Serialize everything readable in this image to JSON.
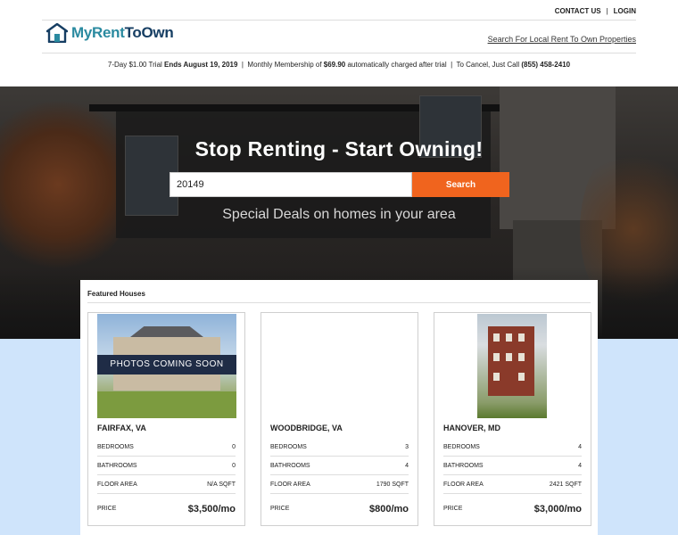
{
  "header": {
    "top_links": {
      "contact": "CONTACT US",
      "separator": "|",
      "login": "LOGIN"
    },
    "logo": {
      "part1": "MyRent",
      "part2": "ToOwn",
      "icon": "house-icon"
    },
    "search_local_link": "Search For Local Rent To Own Properties",
    "trial_bar": {
      "trial_prefix": "7-Day $1.00 Trial ",
      "trial_end": "Ends August 19, 2019",
      "sep1": "  |  ",
      "membership_prefix": "Monthly Membership of ",
      "membership_amount": "$69.90",
      "membership_suffix": " automatically charged after trial",
      "sep2": "  |  ",
      "cancel_prefix": "To Cancel, Just Call ",
      "cancel_phone": "(855) 458-2410"
    }
  },
  "hero": {
    "title": "Stop Renting - Start Owning!",
    "search": {
      "value": "20149",
      "button_label": "Search"
    },
    "subtitle": "Special Deals on homes in your area"
  },
  "featured": {
    "title": "Featured Houses",
    "cards": [
      {
        "city": "FAIRFAX, VA",
        "photo_banner": "PHOTOS COMING SOON",
        "rows": [
          {
            "label": "BEDROOMS",
            "value": "0"
          },
          {
            "label": "BATHROOMS",
            "value": "0"
          },
          {
            "label": "FLOOR AREA",
            "value": "N/A SQFT"
          }
        ],
        "price_label": "PRICE",
        "price": "$3,500/mo"
      },
      {
        "city": "WOODBRIDGE, VA",
        "rows": [
          {
            "label": "BEDROOMS",
            "value": "3"
          },
          {
            "label": "BATHROOMS",
            "value": "4"
          },
          {
            "label": "FLOOR AREA",
            "value": "1790 SQFT"
          }
        ],
        "price_label": "PRICE",
        "price": "$800/mo"
      },
      {
        "city": "HANOVER, MD",
        "rows": [
          {
            "label": "BEDROOMS",
            "value": "4"
          },
          {
            "label": "BATHROOMS",
            "value": "4"
          },
          {
            "label": "FLOOR AREA",
            "value": "2421 SQFT"
          }
        ],
        "price_label": "PRICE",
        "price": "$3,000/mo"
      }
    ]
  },
  "colors": {
    "accent_orange": "#f0641e",
    "logo_teal": "#2a8aa0",
    "logo_navy": "#163e63",
    "lower_background": "#cfe4fb"
  }
}
